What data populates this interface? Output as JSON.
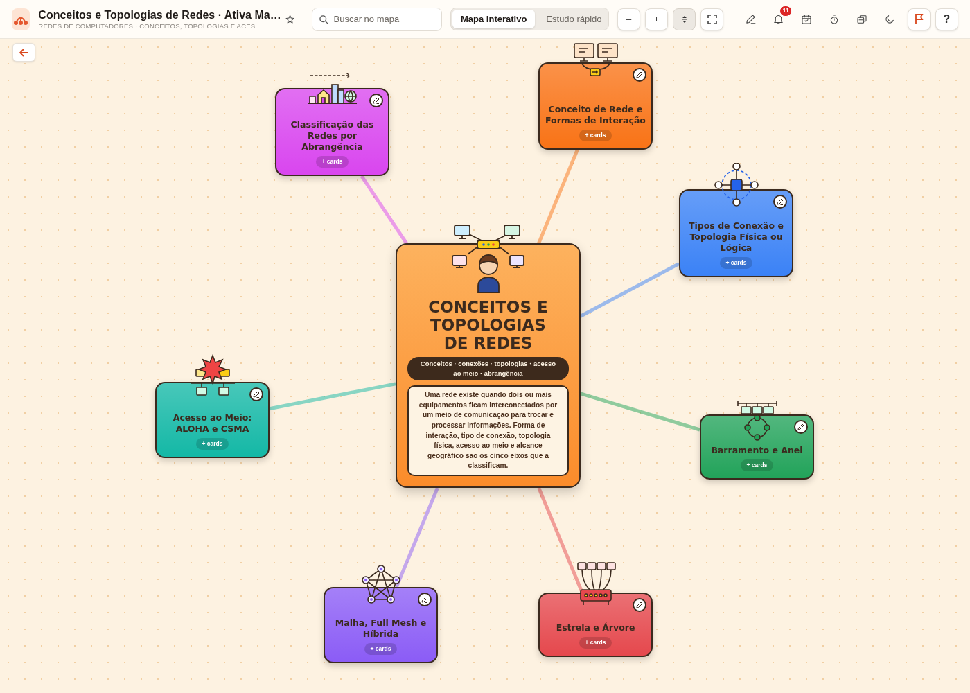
{
  "header": {
    "title": "Conceitos e Topologias de Redes · Ativa Ma…",
    "subtitle": "REDES DE COMPUTADORES · CONCEITOS, TOPOLOGIAS E ACES…"
  },
  "search": {
    "placeholder": "Buscar no mapa"
  },
  "view_tabs": [
    {
      "label": "Mapa interativo",
      "selected": true
    },
    {
      "label": "Estudo rápido",
      "selected": false
    }
  ],
  "zoom_buttons": [
    {
      "label": "–"
    },
    {
      "label": "+"
    }
  ],
  "fit_toggle": {
    "on": true
  },
  "notifications": {
    "count": "11"
  },
  "help_button": {
    "label": "?"
  },
  "center_node": {
    "title": "CONCEITOS E TOPOLOGIAS DE REDES",
    "tags": "Conceitos · conexões · topologias · acesso ao meio · abrangência",
    "description": "Uma rede existe quando dois ou mais equipamentos ficam interconectados por um meio de comunicação para trocar e processar informações. Forma de interação, tipo de conexão, topologia física, acesso ao meio e alcance geográfico são os cinco eixos que a classificam."
  },
  "nodes": [
    {
      "title": "Classificação das Redes por Abrangência",
      "color": "#d946ef",
      "action": "+ cards"
    },
    {
      "title": "Conceito de Rede e Formas de Interação",
      "color": "#f97316",
      "action": "+ cards"
    },
    {
      "title": "Tipos de Conexão e Topologia Física ou Lógica",
      "color": "#3b82f6",
      "action": "+ cards"
    },
    {
      "title": "Acesso ao Meio: ALOHA e CSMA",
      "color": "#14b8a6",
      "action": "+ cards"
    },
    {
      "title": "Barramento e Anel",
      "color": "#22a35a",
      "action": "+ cards"
    },
    {
      "title": "Malha, Full Mesh e Híbrida",
      "color": "#8b5cf6",
      "action": "+ cards"
    },
    {
      "title": "Estrela e Árvore",
      "color": "#e5484d",
      "action": "+ cards"
    }
  ]
}
